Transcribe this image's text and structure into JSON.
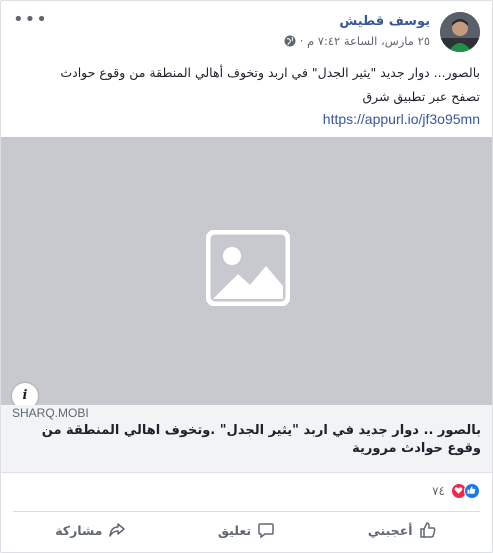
{
  "post": {
    "author": "يوسف قطيش",
    "timestamp": "٢٥ مارس، الساعة ٧:٤٢ م ·",
    "privacy_icon": "globe-icon",
    "menu_label": "•••",
    "text": "بالصور... دوار جديد \"يثير الجدل\" في اربد وتخوف أهالي المنطقة من وقوع حوادث",
    "text_line2": "تصفح عبر تطبيق شرق",
    "link": "https://appurl.io/jf3o95mn"
  },
  "link_preview": {
    "domain": "SHARQ.MOBI",
    "title": "بالصور .. دوار جديد في اربد \"يثير الجدل\" .وتخوف اهالي المنطقة من وقوع حوادث مرورية",
    "info_label": "i",
    "image_icon": "image-placeholder-icon"
  },
  "reactions": {
    "count": "٧٤",
    "types": [
      "like",
      "love"
    ],
    "colors": {
      "like": "#1877f2",
      "love": "#f0284a"
    }
  },
  "actions": {
    "like": "أعجبني",
    "comment": "تعليق",
    "share": "مشاركة"
  },
  "colors": {
    "link": "#385898",
    "secondary_text": "#606770",
    "media_bg": "#c8c9ce"
  }
}
